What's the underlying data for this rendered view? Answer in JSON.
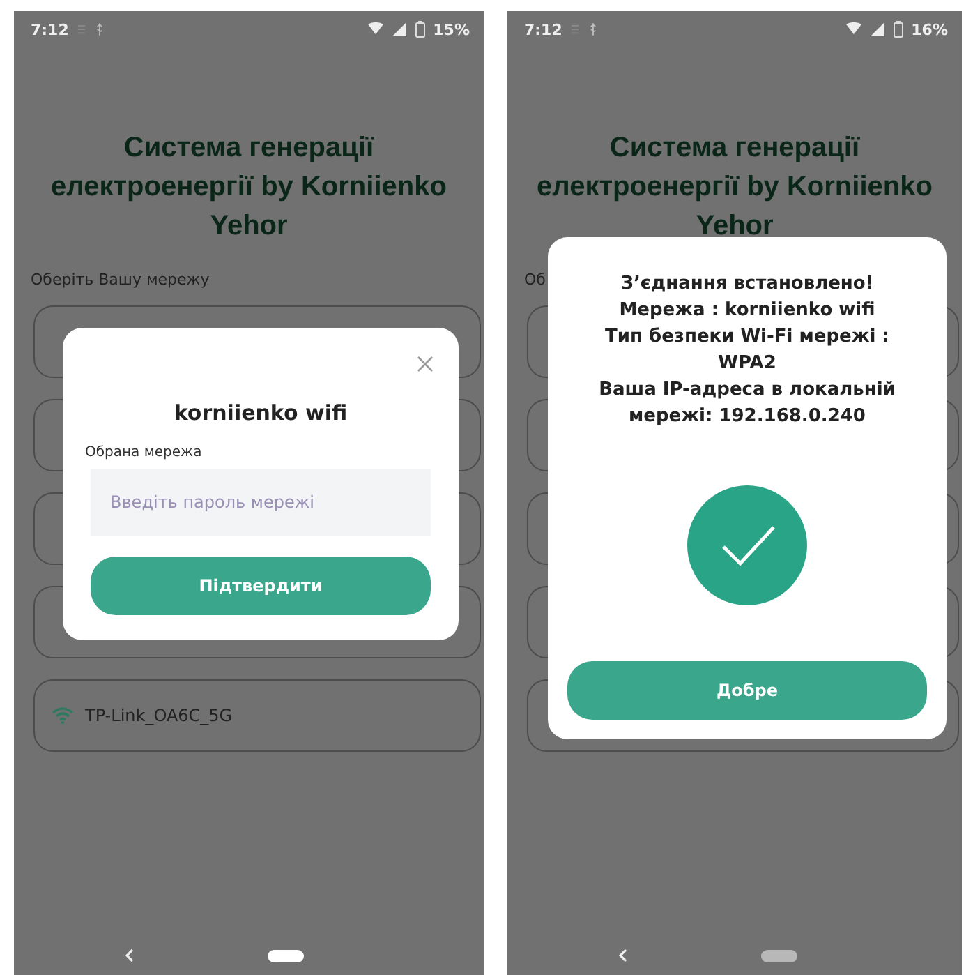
{
  "screens": [
    {
      "status_bar": {
        "time": "7:12",
        "battery": "15%"
      },
      "title": "Система генерації електроенергії by Korniienko Yehor",
      "section_label": "Оберіть Вашу мережу",
      "networks": [
        {
          "covered": true
        },
        {
          "covered": true
        },
        {
          "covered": true
        },
        {
          "covered": true
        },
        {
          "covered": false,
          "name": "TP-Link_OA6C_5G"
        }
      ],
      "dialog": {
        "kind": "password",
        "title": "korniienko wifi",
        "field_label": "Обрана мережа",
        "placeholder": "Введіть пароль мережі",
        "button": "Підтвердити"
      },
      "home_pill_active": true
    },
    {
      "status_bar": {
        "time": "7:12",
        "battery": "16%"
      },
      "title": "Система генерації електроенергії by Korniienko Yehor",
      "section_label": "Об",
      "networks": [
        {
          "covered": true
        },
        {
          "covered": true
        },
        {
          "covered": true
        },
        {
          "covered": true
        },
        {
          "covered": true
        }
      ],
      "dialog": {
        "kind": "success",
        "lines": [
          "З’єднання встановлено!",
          "Мережа : korniienko wifi",
          "Тип безпеки Wi-Fi мережі :",
          "WPA2",
          "Ваша IP-адреса в локальній",
          "мережі: 192.168.0.240"
        ],
        "button": "Добре"
      },
      "home_pill_active": false
    }
  ]
}
